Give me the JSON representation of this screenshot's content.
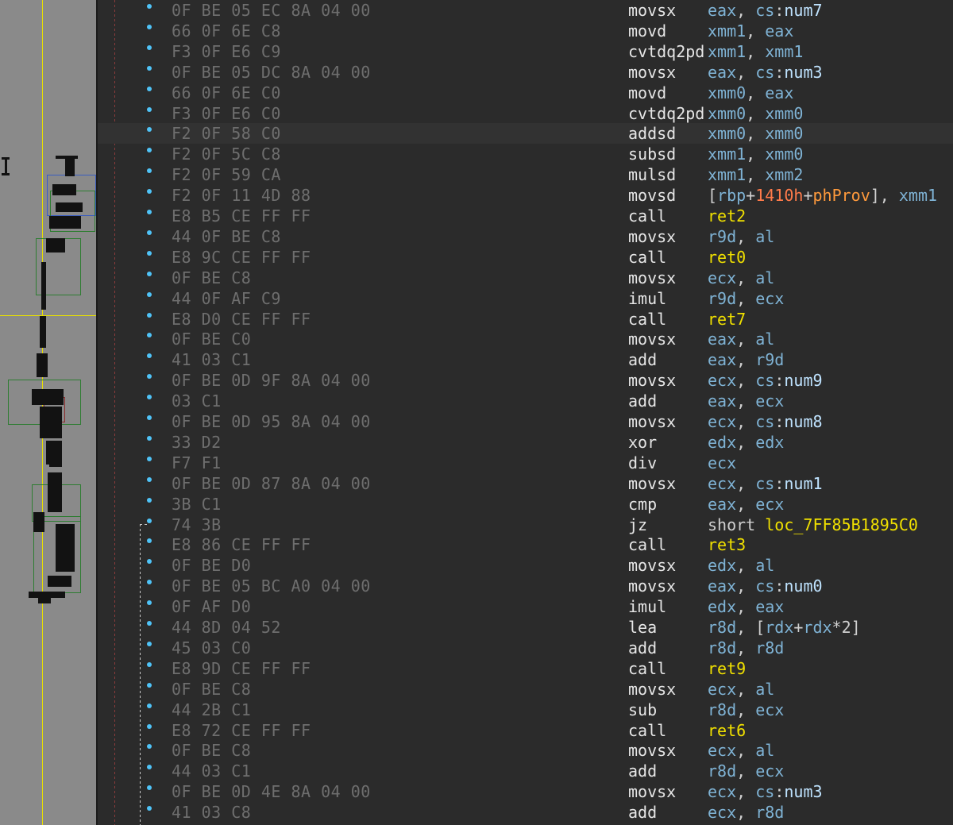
{
  "listing": [
    {
      "bytes": "0F BE 05 EC 8A 04 00",
      "mnem": "movsx",
      "ops": [
        [
          "reg",
          "eax"
        ],
        [
          "punct",
          ", "
        ],
        [
          "reg",
          "cs"
        ],
        [
          "punct",
          ":"
        ],
        [
          "sym",
          "num7"
        ]
      ]
    },
    {
      "bytes": "66 0F 6E C8",
      "mnem": "movd",
      "ops": [
        [
          "reg",
          "xmm1"
        ],
        [
          "punct",
          ", "
        ],
        [
          "reg",
          "eax"
        ]
      ]
    },
    {
      "bytes": "F3 0F E6 C9",
      "mnem": "cvtdq2pd",
      "ops": [
        [
          "reg",
          "xmm1"
        ],
        [
          "punct",
          ", "
        ],
        [
          "reg",
          "xmm1"
        ]
      ]
    },
    {
      "bytes": "0F BE 05 DC 8A 04 00",
      "mnem": "movsx",
      "ops": [
        [
          "reg",
          "eax"
        ],
        [
          "punct",
          ", "
        ],
        [
          "reg",
          "cs"
        ],
        [
          "punct",
          ":"
        ],
        [
          "sym",
          "num3"
        ]
      ]
    },
    {
      "bytes": "66 0F 6E C0",
      "mnem": "movd",
      "ops": [
        [
          "reg",
          "xmm0"
        ],
        [
          "punct",
          ", "
        ],
        [
          "reg",
          "eax"
        ]
      ]
    },
    {
      "bytes": "F3 0F E6 C0",
      "mnem": "cvtdq2pd",
      "ops": [
        [
          "reg",
          "xmm0"
        ],
        [
          "punct",
          ", "
        ],
        [
          "reg",
          "xmm0"
        ]
      ]
    },
    {
      "bytes": "F2 0F 58 C0",
      "mnem": "addsd",
      "ops": [
        [
          "reg",
          "xmm0"
        ],
        [
          "punct",
          ", "
        ],
        [
          "reg",
          "xmm0"
        ]
      ],
      "highlight": true
    },
    {
      "bytes": "F2 0F 5C C8",
      "mnem": "subsd",
      "ops": [
        [
          "reg",
          "xmm1"
        ],
        [
          "punct",
          ", "
        ],
        [
          "reg",
          "xmm0"
        ]
      ]
    },
    {
      "bytes": "F2 0F 59 CA",
      "mnem": "mulsd",
      "ops": [
        [
          "reg",
          "xmm1"
        ],
        [
          "punct",
          ", "
        ],
        [
          "reg",
          "xmm2"
        ]
      ]
    },
    {
      "bytes": "F2 0F 11 4D 88",
      "mnem": "movsd",
      "ops": [
        [
          "punct",
          "["
        ],
        [
          "reg",
          "rbp"
        ],
        [
          "punct",
          "+"
        ],
        [
          "num",
          "1410h"
        ],
        [
          "punct",
          "+"
        ],
        [
          "var",
          "phProv"
        ],
        [
          "punct",
          "], "
        ],
        [
          "reg",
          "xmm1"
        ]
      ]
    },
    {
      "bytes": "E8 B5 CE FF FF",
      "mnem": "call",
      "ops": [
        [
          "fn",
          "ret2"
        ]
      ]
    },
    {
      "bytes": "44 0F BE C8",
      "mnem": "movsx",
      "ops": [
        [
          "reg",
          "r9d"
        ],
        [
          "punct",
          ", "
        ],
        [
          "reg",
          "al"
        ]
      ]
    },
    {
      "bytes": "E8 9C CE FF FF",
      "mnem": "call",
      "ops": [
        [
          "fn",
          "ret0"
        ]
      ]
    },
    {
      "bytes": "0F BE C8",
      "mnem": "movsx",
      "ops": [
        [
          "reg",
          "ecx"
        ],
        [
          "punct",
          ", "
        ],
        [
          "reg",
          "al"
        ]
      ]
    },
    {
      "bytes": "44 0F AF C9",
      "mnem": "imul",
      "ops": [
        [
          "reg",
          "r9d"
        ],
        [
          "punct",
          ", "
        ],
        [
          "reg",
          "ecx"
        ]
      ]
    },
    {
      "bytes": "E8 D0 CE FF FF",
      "mnem": "call",
      "ops": [
        [
          "fn",
          "ret7"
        ]
      ]
    },
    {
      "bytes": "0F BE C0",
      "mnem": "movsx",
      "ops": [
        [
          "reg",
          "eax"
        ],
        [
          "punct",
          ", "
        ],
        [
          "reg",
          "al"
        ]
      ]
    },
    {
      "bytes": "41 03 C1",
      "mnem": "add",
      "ops": [
        [
          "reg",
          "eax"
        ],
        [
          "punct",
          ", "
        ],
        [
          "reg",
          "r9d"
        ]
      ]
    },
    {
      "bytes": "0F BE 0D 9F 8A 04 00",
      "mnem": "movsx",
      "ops": [
        [
          "reg",
          "ecx"
        ],
        [
          "punct",
          ", "
        ],
        [
          "reg",
          "cs"
        ],
        [
          "punct",
          ":"
        ],
        [
          "sym",
          "num9"
        ]
      ]
    },
    {
      "bytes": "03 C1",
      "mnem": "add",
      "ops": [
        [
          "reg",
          "eax"
        ],
        [
          "punct",
          ", "
        ],
        [
          "reg",
          "ecx"
        ]
      ]
    },
    {
      "bytes": "0F BE 0D 95 8A 04 00",
      "mnem": "movsx",
      "ops": [
        [
          "reg",
          "ecx"
        ],
        [
          "punct",
          ", "
        ],
        [
          "reg",
          "cs"
        ],
        [
          "punct",
          ":"
        ],
        [
          "sym",
          "num8"
        ]
      ]
    },
    {
      "bytes": "33 D2",
      "mnem": "xor",
      "ops": [
        [
          "reg",
          "edx"
        ],
        [
          "punct",
          ", "
        ],
        [
          "reg",
          "edx"
        ]
      ]
    },
    {
      "bytes": "F7 F1",
      "mnem": "div",
      "ops": [
        [
          "reg",
          "ecx"
        ]
      ]
    },
    {
      "bytes": "0F BE 0D 87 8A 04 00",
      "mnem": "movsx",
      "ops": [
        [
          "reg",
          "ecx"
        ],
        [
          "punct",
          ", "
        ],
        [
          "reg",
          "cs"
        ],
        [
          "punct",
          ":"
        ],
        [
          "sym",
          "num1"
        ]
      ]
    },
    {
      "bytes": "3B C1",
      "mnem": "cmp",
      "ops": [
        [
          "reg",
          "eax"
        ],
        [
          "punct",
          ", "
        ],
        [
          "reg",
          "ecx"
        ]
      ]
    },
    {
      "bytes": "74 3B",
      "mnem": "jz",
      "ops": [
        [
          "kw",
          "short "
        ],
        [
          "fn",
          "loc_7FF85B1895C0"
        ]
      ]
    },
    {
      "bytes": "E8 86 CE FF FF",
      "mnem": "call",
      "ops": [
        [
          "fn",
          "ret3"
        ]
      ]
    },
    {
      "bytes": "0F BE D0",
      "mnem": "movsx",
      "ops": [
        [
          "reg",
          "edx"
        ],
        [
          "punct",
          ", "
        ],
        [
          "reg",
          "al"
        ]
      ]
    },
    {
      "bytes": "0F BE 05 BC A0 04 00",
      "mnem": "movsx",
      "ops": [
        [
          "reg",
          "eax"
        ],
        [
          "punct",
          ", "
        ],
        [
          "reg",
          "cs"
        ],
        [
          "punct",
          ":"
        ],
        [
          "sym",
          "num0"
        ]
      ]
    },
    {
      "bytes": "0F AF D0",
      "mnem": "imul",
      "ops": [
        [
          "reg",
          "edx"
        ],
        [
          "punct",
          ", "
        ],
        [
          "reg",
          "eax"
        ]
      ]
    },
    {
      "bytes": "44 8D 04 52",
      "mnem": "lea",
      "ops": [
        [
          "reg",
          "r8d"
        ],
        [
          "punct",
          ", ["
        ],
        [
          "reg",
          "rdx"
        ],
        [
          "punct",
          "+"
        ],
        [
          "reg",
          "rdx"
        ],
        [
          "punct",
          "*2]"
        ]
      ]
    },
    {
      "bytes": "45 03 C0",
      "mnem": "add",
      "ops": [
        [
          "reg",
          "r8d"
        ],
        [
          "punct",
          ", "
        ],
        [
          "reg",
          "r8d"
        ]
      ]
    },
    {
      "bytes": "E8 9D CE FF FF",
      "mnem": "call",
      "ops": [
        [
          "fn",
          "ret9"
        ]
      ]
    },
    {
      "bytes": "0F BE C8",
      "mnem": "movsx",
      "ops": [
        [
          "reg",
          "ecx"
        ],
        [
          "punct",
          ", "
        ],
        [
          "reg",
          "al"
        ]
      ]
    },
    {
      "bytes": "44 2B C1",
      "mnem": "sub",
      "ops": [
        [
          "reg",
          "r8d"
        ],
        [
          "punct",
          ", "
        ],
        [
          "reg",
          "ecx"
        ]
      ]
    },
    {
      "bytes": "E8 72 CE FF FF",
      "mnem": "call",
      "ops": [
        [
          "fn",
          "ret6"
        ]
      ]
    },
    {
      "bytes": "0F BE C8",
      "mnem": "movsx",
      "ops": [
        [
          "reg",
          "ecx"
        ],
        [
          "punct",
          ", "
        ],
        [
          "reg",
          "al"
        ]
      ]
    },
    {
      "bytes": "44 03 C1",
      "mnem": "add",
      "ops": [
        [
          "reg",
          "r8d"
        ],
        [
          "punct",
          ", "
        ],
        [
          "reg",
          "ecx"
        ]
      ]
    },
    {
      "bytes": "0F BE 0D 4E 8A 04 00",
      "mnem": "movsx",
      "ops": [
        [
          "reg",
          "ecx"
        ],
        [
          "punct",
          ", "
        ],
        [
          "reg",
          "cs"
        ],
        [
          "punct",
          ":"
        ],
        [
          "sym",
          "num3"
        ]
      ]
    },
    {
      "bytes": "41 03 C8",
      "mnem": "add",
      "ops": [
        [
          "reg",
          "ecx"
        ],
        [
          "punct",
          ", "
        ],
        [
          "reg",
          "r8d"
        ]
      ]
    }
  ]
}
